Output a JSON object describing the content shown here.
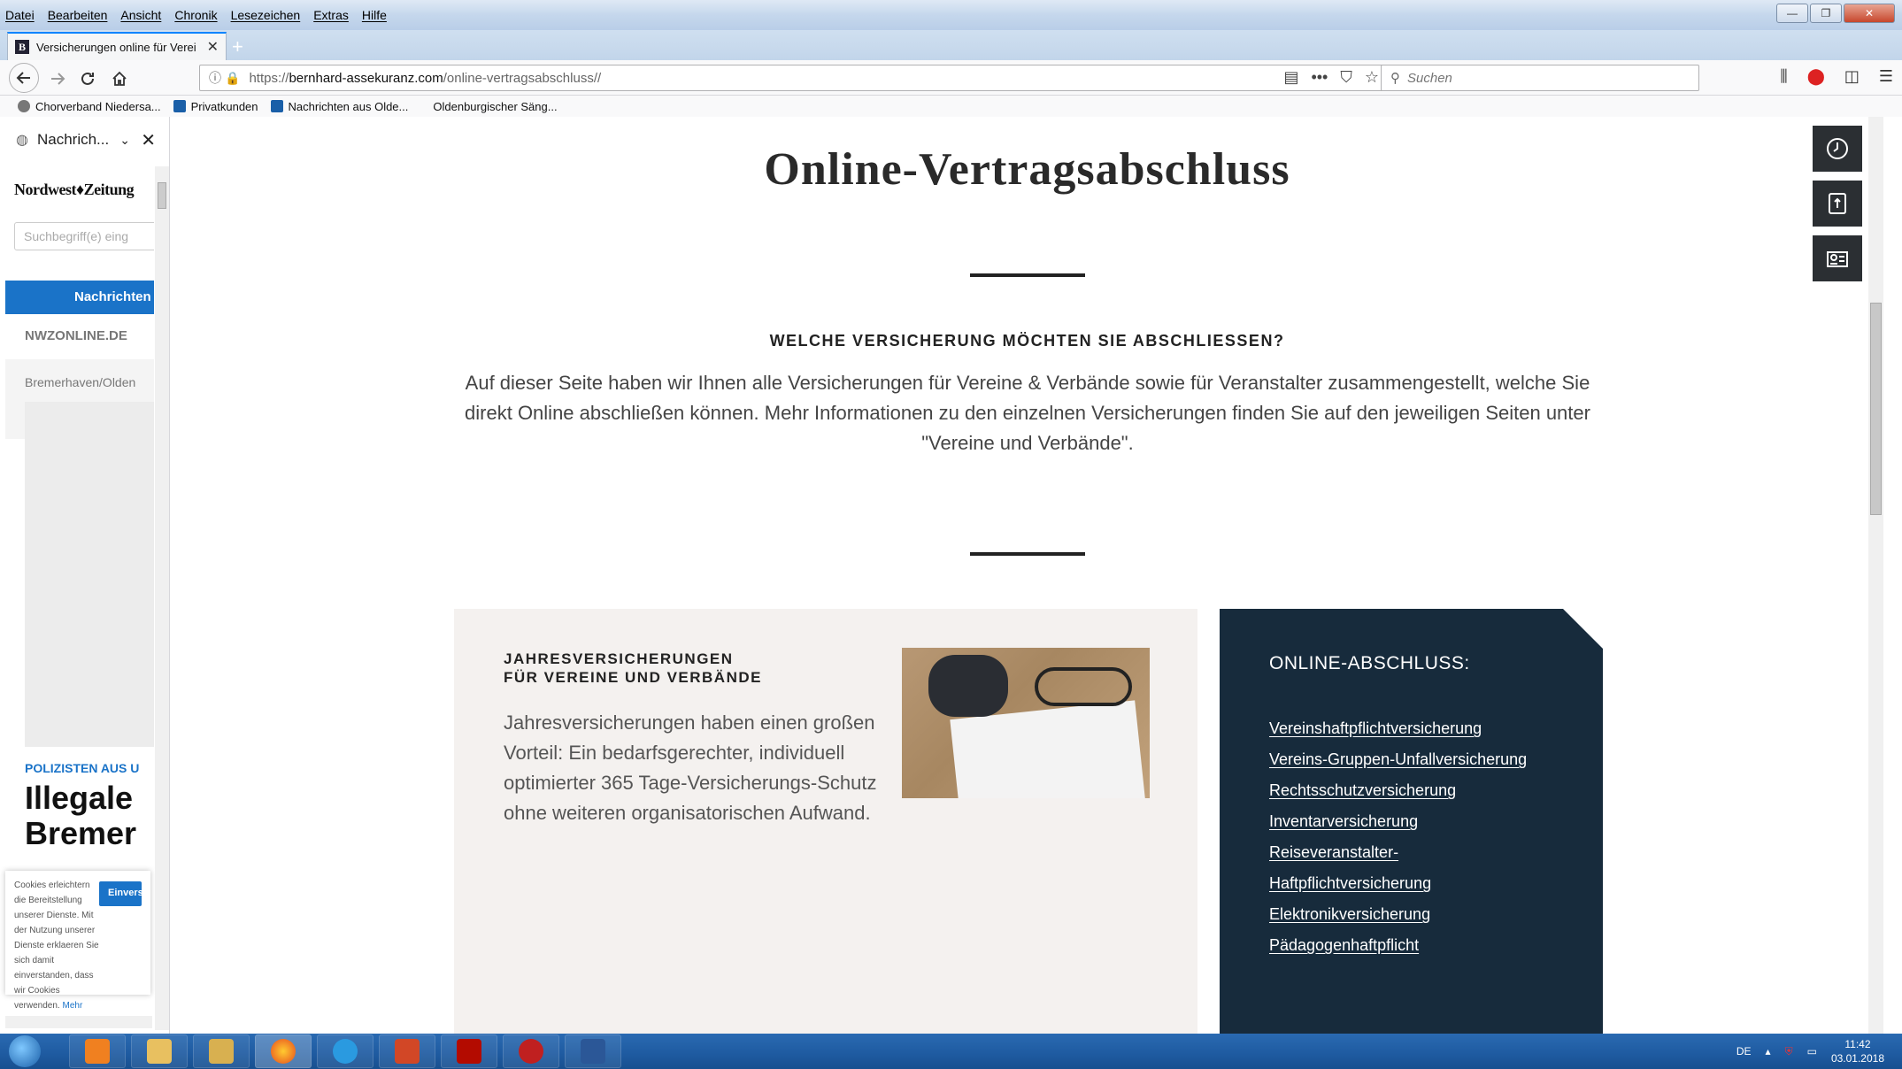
{
  "menubar": {
    "items": [
      "Datei",
      "Bearbeiten",
      "Ansicht",
      "Chronik",
      "Lesezeichen",
      "Extras",
      "Hilfe"
    ]
  },
  "tab": {
    "favicon": "B",
    "title": "Versicherungen online für Verei",
    "close": "✕",
    "new_tab": "+"
  },
  "nav": {
    "url_prefix": "https://",
    "url_host": "bernhard-assekuranz.com",
    "url_path": "/online-vertragsabschluss//",
    "search_placeholder": "Suchen"
  },
  "bookmarks": [
    {
      "label": "Chorverband Niedersa...",
      "color": "#666666"
    },
    {
      "label": "Privatkunden",
      "color": "#1a5fa8"
    },
    {
      "label": "Nachrichten aus Olde...",
      "color": "#1a5fa8"
    },
    {
      "label": "Oldenburgischer Säng...",
      "color": "#ffffff"
    }
  ],
  "sidebar": {
    "header_title": "Nachrich...",
    "logo": "Nordwest♦Zeitung",
    "search_placeholder": "Suchbegriff(e) eing",
    "tab_label": "Nachrichten",
    "site": "NWZONLINE.DE",
    "region": "Bremerhaven/Olden",
    "kicker": "POLIZISTEN AUS U",
    "headline_1": "Illegale",
    "headline_2": "Bremer",
    "cookie_text": "Cookies erleichtern die Bereitstellung unserer Dienste. Mit der Nutzung unserer Dienste erklaeren Sie sich damit einverstanden, dass wir Cookies verwenden.",
    "cookie_link": "Mehr infos",
    "cookie_button": "Einverst"
  },
  "page": {
    "title": "Online-Vertragsabschluss",
    "subheading": "WELCHE VERSICHERUNG MÖCHTEN SIE ABSCHLIESSEN?",
    "intro": "Auf dieser Seite haben wir Ihnen alle Versicherungen für Vereine & Verbände sowie für Veranstalter zusammengestellt, welche Sie direkt Online abschließen können. Mehr Informationen zu den einzelnen Versicherungen finden Sie auf den jeweiligen Seiten unter \"Vereine und Verbände\".",
    "card_left": {
      "heading_1": "JAHRESVERSICHERUNGEN",
      "heading_2": "FÜR VEREINE UND VERBÄNDE",
      "body": "Jahresversicherungen haben einen großen Vorteil: Ein bedarfsgerechter, individuell optimierter 365 Tage-Versicherungs-Schutz ohne weiteren organisatorischen Aufwand."
    },
    "card_right": {
      "heading": "ONLINE-ABSCHLUSS:",
      "links": [
        "Vereinshaftpflichtversicherung",
        "Vereins-Gruppen-Unfallversicherung",
        "Rechtsschutzversicherung",
        "Inventarversicherung",
        "Reiseveranstalter-",
        "Haftpflichtversicherung",
        "Elektronikversicherung",
        "Pädagogenhaftpflicht"
      ]
    }
  },
  "taskbar": {
    "lang": "DE",
    "time": "11:42",
    "date": "03.01.2018"
  },
  "colors": {
    "accent": "#0a84ff",
    "navy_card": "#172b3c",
    "beige_card": "#f4f1ef",
    "nwz_blue": "#1a73c8"
  }
}
